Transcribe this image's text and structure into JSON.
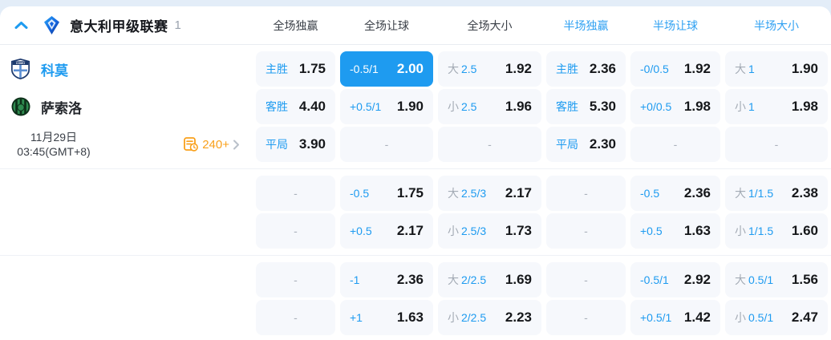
{
  "colors": {
    "page_bg": "#e3edf8",
    "card_bg": "#ffffff",
    "cell_bg": "#f6f8fc",
    "accent_blue": "#1e9bf0",
    "half_header_blue": "#2ea0f2",
    "dark_text": "#15171a",
    "gray_text": "#a4abb5",
    "orange": "#f9a01b"
  },
  "ui": {
    "dash": "-"
  },
  "icons": {
    "chevron_up": "collapse-league-toggle",
    "league_logo": "serie-a-logo",
    "home_logo": "como-crest",
    "away_logo": "sassuolo-crest",
    "markets": "markets-list-clock-icon",
    "chevron_right": "open-more-markets"
  },
  "header": {
    "league": "意大利甲级联赛",
    "count": "1",
    "columns": [
      {
        "label": "全场独赢",
        "type": "full"
      },
      {
        "label": "全场让球",
        "type": "full"
      },
      {
        "label": "全场大小",
        "type": "full"
      },
      {
        "label": "半场独赢",
        "type": "half"
      },
      {
        "label": "半场让球",
        "type": "half"
      },
      {
        "label": "半场大小",
        "type": "half"
      }
    ]
  },
  "match": {
    "home": "科莫",
    "away": "萨索洛",
    "date": "11月29日",
    "time": "03:45(GMT+8)",
    "more_count": "240+"
  },
  "sections": [
    {
      "rows": [
        {
          "cells": [
            {
              "t": "win",
              "label": "主胜",
              "value": "1.75"
            },
            {
              "t": "hcp",
              "label": "-0.5/1",
              "value": "2.00",
              "highlight": true
            },
            {
              "t": "ou",
              "side": "大",
              "line": "2.5",
              "value": "1.92"
            },
            {
              "t": "win",
              "label": "主胜",
              "value": "2.36"
            },
            {
              "t": "hcp",
              "label": "-0/0.5",
              "value": "1.92"
            },
            {
              "t": "ou",
              "side": "大",
              "line": "1",
              "value": "1.90"
            }
          ]
        },
        {
          "cells": [
            {
              "t": "win",
              "label": "客胜",
              "value": "4.40"
            },
            {
              "t": "hcp",
              "label": "+0.5/1",
              "value": "1.90"
            },
            {
              "t": "ou",
              "side": "小",
              "line": "2.5",
              "value": "1.96"
            },
            {
              "t": "win",
              "label": "客胜",
              "value": "5.30"
            },
            {
              "t": "hcp",
              "label": "+0/0.5",
              "value": "1.98"
            },
            {
              "t": "ou",
              "side": "小",
              "line": "1",
              "value": "1.98"
            }
          ]
        },
        {
          "cells": [
            {
              "t": "win",
              "label": "平局",
              "value": "3.90"
            },
            {
              "t": "dash"
            },
            {
              "t": "dash"
            },
            {
              "t": "win",
              "label": "平局",
              "value": "2.30"
            },
            {
              "t": "dash"
            },
            {
              "t": "dash"
            }
          ]
        }
      ]
    },
    {
      "rows": [
        {
          "cells": [
            {
              "t": "dash"
            },
            {
              "t": "hcp",
              "label": "-0.5",
              "value": "1.75"
            },
            {
              "t": "ou",
              "side": "大",
              "line": "2.5/3",
              "value": "2.17"
            },
            {
              "t": "dash"
            },
            {
              "t": "hcp",
              "label": "-0.5",
              "value": "2.36"
            },
            {
              "t": "ou",
              "side": "大",
              "line": "1/1.5",
              "value": "2.38"
            }
          ]
        },
        {
          "cells": [
            {
              "t": "dash"
            },
            {
              "t": "hcp",
              "label": "+0.5",
              "value": "2.17"
            },
            {
              "t": "ou",
              "side": "小",
              "line": "2.5/3",
              "value": "1.73"
            },
            {
              "t": "dash"
            },
            {
              "t": "hcp",
              "label": "+0.5",
              "value": "1.63"
            },
            {
              "t": "ou",
              "side": "小",
              "line": "1/1.5",
              "value": "1.60"
            }
          ]
        }
      ]
    },
    {
      "rows": [
        {
          "cells": [
            {
              "t": "dash"
            },
            {
              "t": "hcp",
              "label": "-1",
              "value": "2.36"
            },
            {
              "t": "ou",
              "side": "大",
              "line": "2/2.5",
              "value": "1.69"
            },
            {
              "t": "dash"
            },
            {
              "t": "hcp",
              "label": "-0.5/1",
              "value": "2.92"
            },
            {
              "t": "ou",
              "side": "大",
              "line": "0.5/1",
              "value": "1.56"
            }
          ]
        },
        {
          "cells": [
            {
              "t": "dash"
            },
            {
              "t": "hcp",
              "label": "+1",
              "value": "1.63"
            },
            {
              "t": "ou",
              "side": "小",
              "line": "2/2.5",
              "value": "2.23"
            },
            {
              "t": "dash"
            },
            {
              "t": "hcp",
              "label": "+0.5/1",
              "value": "1.42"
            },
            {
              "t": "ou",
              "side": "小",
              "line": "0.5/1",
              "value": "2.47"
            }
          ]
        }
      ]
    }
  ]
}
